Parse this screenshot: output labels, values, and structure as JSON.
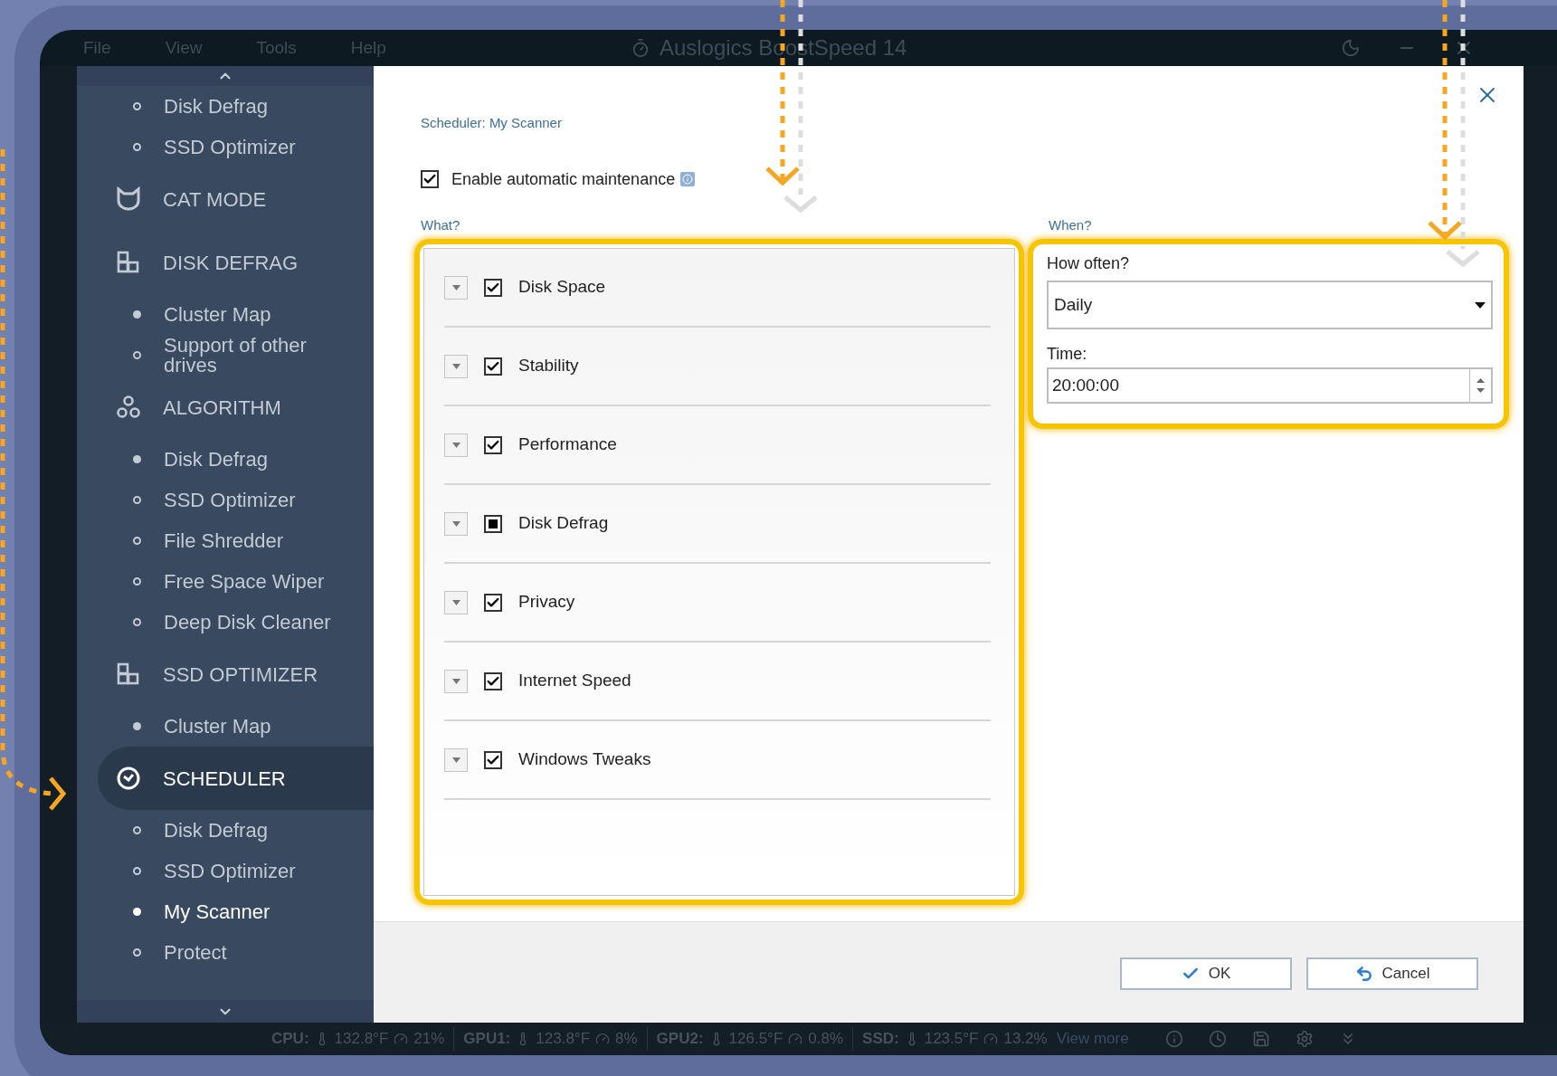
{
  "app": {
    "menu": [
      "File",
      "View",
      "Tools",
      "Help"
    ],
    "title": "Auslogics BoostSpeed 14"
  },
  "sidebar": {
    "items": [
      {
        "kind": "item",
        "label": "Disk Defrag",
        "filled": false,
        "selected": false
      },
      {
        "kind": "item",
        "label": "SSD Optimizer",
        "filled": false,
        "selected": false
      },
      {
        "kind": "section",
        "label": "CAT MODE",
        "selected": false
      },
      {
        "kind": "section",
        "label": "DISK DEFRAG",
        "selected": false,
        "children": [
          {
            "label": "Cluster Map",
            "filled": true,
            "selected": false
          },
          {
            "label": "Support of other drives",
            "filled": false,
            "selected": false
          }
        ]
      },
      {
        "kind": "section",
        "label": "ALGORITHM",
        "selected": false,
        "children": [
          {
            "label": "Disk Defrag",
            "filled": true,
            "selected": false
          },
          {
            "label": "SSD Optimizer",
            "filled": false,
            "selected": false
          },
          {
            "label": "File Shredder",
            "filled": false,
            "selected": false
          },
          {
            "label": "Free Space Wiper",
            "filled": false,
            "selected": false
          },
          {
            "label": "Deep Disk Cleaner",
            "filled": false,
            "selected": false
          }
        ]
      },
      {
        "kind": "section",
        "label": "SSD OPTIMIZER",
        "selected": false,
        "children": [
          {
            "label": "Cluster Map",
            "filled": true,
            "selected": false
          }
        ]
      },
      {
        "kind": "section",
        "label": "SCHEDULER",
        "selected": true,
        "children": [
          {
            "label": "Disk Defrag",
            "filled": false,
            "selected": false
          },
          {
            "label": "SSD Optimizer",
            "filled": false,
            "selected": false
          },
          {
            "label": "My Scanner",
            "filled": true,
            "selected": true
          },
          {
            "label": "Protect",
            "filled": false,
            "selected": false
          }
        ]
      }
    ]
  },
  "dialog": {
    "breadcrumb": "Scheduler: My Scanner",
    "enable": {
      "label": "Enable automatic maintenance",
      "checked": true
    },
    "what": {
      "heading": "What?",
      "items": [
        {
          "label": "Disk Space",
          "checked": true,
          "partial": false
        },
        {
          "label": "Stability",
          "checked": true,
          "partial": false
        },
        {
          "label": "Performance",
          "checked": true,
          "partial": false
        },
        {
          "label": "Disk Defrag",
          "checked": true,
          "partial": true
        },
        {
          "label": "Privacy",
          "checked": true,
          "partial": false
        },
        {
          "label": "Internet Speed",
          "checked": true,
          "partial": false
        },
        {
          "label": "Windows Tweaks",
          "checked": true,
          "partial": false
        }
      ]
    },
    "when": {
      "heading": "When?",
      "frequency_label": "How often?",
      "frequency": "Daily",
      "time_label": "Time:",
      "time": "20:00:00"
    },
    "buttons": [
      {
        "label": "OK",
        "kind": "ok"
      },
      {
        "label": "Cancel",
        "kind": "cancel"
      }
    ]
  },
  "status_bar": {
    "sensors": [
      {
        "name": "CPU:",
        "temperature": "132.8°F",
        "load": "21%"
      },
      {
        "name": "GPU1:",
        "temperature": "123.8°F",
        "load": "8%"
      },
      {
        "name": "GPU2:",
        "temperature": "126.5°F",
        "load": "0.8%"
      },
      {
        "name": "SSD:",
        "temperature": "123.5°F",
        "load": "13.2%"
      }
    ],
    "link": "View more"
  }
}
